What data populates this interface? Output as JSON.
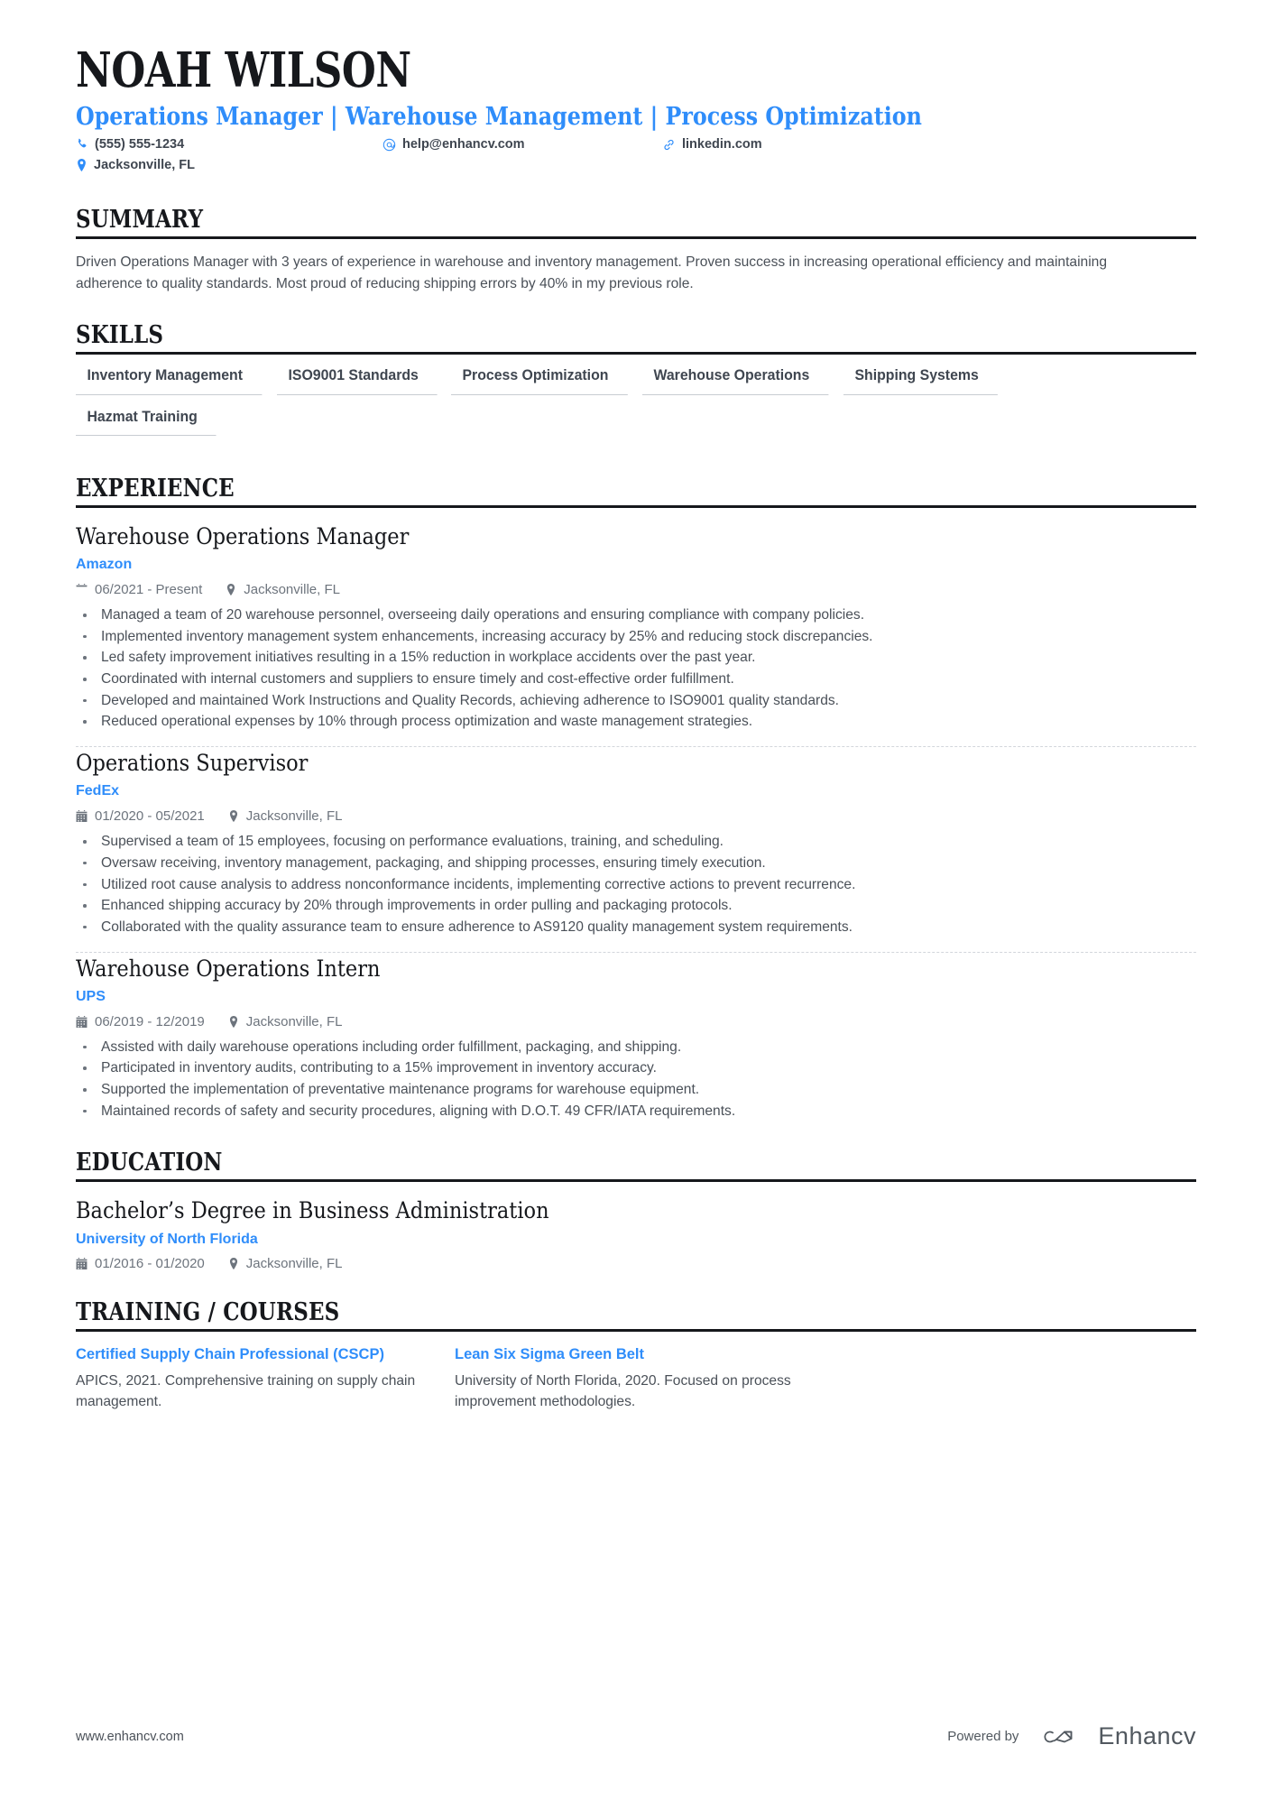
{
  "header": {
    "name": "NOAH WILSON",
    "headline": "Operations Manager | Warehouse Management | Process Optimization",
    "contacts": {
      "phone": "(555) 555-1234",
      "email": "help@enhancv.com",
      "linkedin": "linkedin.com",
      "location": "Jacksonville, FL"
    }
  },
  "colors": {
    "accent": "#2f8dfa",
    "heading": "#16181c",
    "body": "#4a5058",
    "muted": "#6d747d",
    "rule": "#c8ccd2"
  },
  "sections": {
    "summary": {
      "title": "SUMMARY",
      "text": "Driven Operations Manager with 3 years of experience in warehouse and inventory management. Proven success in increasing operational efficiency and maintaining adherence to quality standards. Most proud of reducing shipping errors by 40% in my previous role."
    },
    "skills": {
      "title": "SKILLS",
      "items": [
        "Inventory Management",
        "ISO9001 Standards",
        "Process Optimization",
        "Warehouse Operations",
        "Shipping Systems",
        "Hazmat Training"
      ]
    },
    "experience": {
      "title": "EXPERIENCE",
      "entries": [
        {
          "title": "Warehouse Operations Manager",
          "org": "Amazon",
          "dates": "06/2021 - Present",
          "location": "Jacksonville, FL",
          "bullets": [
            "Managed a team of 20 warehouse personnel, overseeing daily operations and ensuring compliance with company policies.",
            "Implemented inventory management system enhancements, increasing accuracy by 25% and reducing stock discrepancies.",
            "Led safety improvement initiatives resulting in a 15% reduction in workplace accidents over the past year.",
            "Coordinated with internal customers and suppliers to ensure timely and cost-effective order fulfillment.",
            "Developed and maintained Work Instructions and Quality Records, achieving adherence to ISO9001 quality standards.",
            "Reduced operational expenses by 10% through process optimization and waste management strategies."
          ]
        },
        {
          "title": "Operations Supervisor",
          "org": "FedEx",
          "dates": "01/2020 - 05/2021",
          "location": "Jacksonville, FL",
          "bullets": [
            "Supervised a team of 15 employees, focusing on performance evaluations, training, and scheduling.",
            "Oversaw receiving, inventory management, packaging, and shipping processes, ensuring timely execution.",
            "Utilized root cause analysis to address nonconformance incidents, implementing corrective actions to prevent recurrence.",
            "Enhanced shipping accuracy by 20% through improvements in order pulling and packaging protocols.",
            "Collaborated with the quality assurance team to ensure adherence to AS9120 quality management system requirements."
          ]
        },
        {
          "title": "Warehouse Operations Intern",
          "org": "UPS",
          "dates": "06/2019 - 12/2019",
          "location": "Jacksonville, FL",
          "bullets": [
            "Assisted with daily warehouse operations including order fulfillment, packaging, and shipping.",
            "Participated in inventory audits, contributing to a 15% improvement in inventory accuracy.",
            "Supported the implementation of preventative maintenance programs for warehouse equipment.",
            "Maintained records of safety and security procedures, aligning with D.O.T. 49 CFR/IATA requirements."
          ]
        }
      ]
    },
    "education": {
      "title": "EDUCATION",
      "entries": [
        {
          "title": "Bachelor’s Degree in Business Administration",
          "org": "University of North Florida",
          "dates": "01/2016 - 01/2020",
          "location": "Jacksonville, FL"
        }
      ]
    },
    "training": {
      "title": "TRAINING / COURSES",
      "courses": [
        {
          "title": "Certified Supply Chain Professional (CSCP)",
          "desc": "APICS, 2021. Comprehensive training on supply chain management."
        },
        {
          "title": "Lean Six Sigma Green Belt",
          "desc": "University of North Florida, 2020. Focused on process improvement methodologies."
        }
      ]
    }
  },
  "footer": {
    "url": "www.enhancv.com",
    "powered_by": "Powered by",
    "brand": "Enhancv"
  }
}
